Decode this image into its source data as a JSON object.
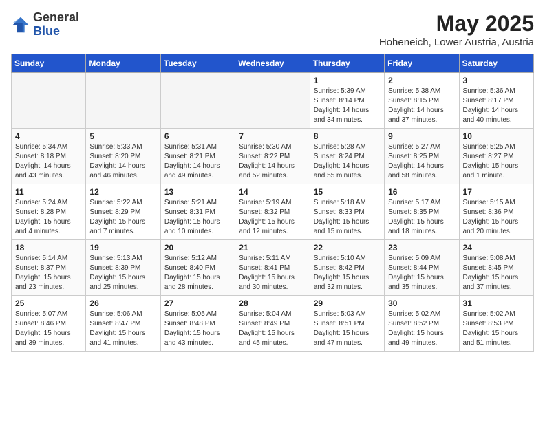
{
  "logo": {
    "general": "General",
    "blue": "Blue"
  },
  "title": {
    "month": "May 2025",
    "location": "Hoheneich, Lower Austria, Austria"
  },
  "weekdays": [
    "Sunday",
    "Monday",
    "Tuesday",
    "Wednesday",
    "Thursday",
    "Friday",
    "Saturday"
  ],
  "weeks": [
    [
      {
        "day": "",
        "info": ""
      },
      {
        "day": "",
        "info": ""
      },
      {
        "day": "",
        "info": ""
      },
      {
        "day": "",
        "info": ""
      },
      {
        "day": "1",
        "info": "Sunrise: 5:39 AM\nSunset: 8:14 PM\nDaylight: 14 hours\nand 34 minutes."
      },
      {
        "day": "2",
        "info": "Sunrise: 5:38 AM\nSunset: 8:15 PM\nDaylight: 14 hours\nand 37 minutes."
      },
      {
        "day": "3",
        "info": "Sunrise: 5:36 AM\nSunset: 8:17 PM\nDaylight: 14 hours\nand 40 minutes."
      }
    ],
    [
      {
        "day": "4",
        "info": "Sunrise: 5:34 AM\nSunset: 8:18 PM\nDaylight: 14 hours\nand 43 minutes."
      },
      {
        "day": "5",
        "info": "Sunrise: 5:33 AM\nSunset: 8:20 PM\nDaylight: 14 hours\nand 46 minutes."
      },
      {
        "day": "6",
        "info": "Sunrise: 5:31 AM\nSunset: 8:21 PM\nDaylight: 14 hours\nand 49 minutes."
      },
      {
        "day": "7",
        "info": "Sunrise: 5:30 AM\nSunset: 8:22 PM\nDaylight: 14 hours\nand 52 minutes."
      },
      {
        "day": "8",
        "info": "Sunrise: 5:28 AM\nSunset: 8:24 PM\nDaylight: 14 hours\nand 55 minutes."
      },
      {
        "day": "9",
        "info": "Sunrise: 5:27 AM\nSunset: 8:25 PM\nDaylight: 14 hours\nand 58 minutes."
      },
      {
        "day": "10",
        "info": "Sunrise: 5:25 AM\nSunset: 8:27 PM\nDaylight: 15 hours\nand 1 minute."
      }
    ],
    [
      {
        "day": "11",
        "info": "Sunrise: 5:24 AM\nSunset: 8:28 PM\nDaylight: 15 hours\nand 4 minutes."
      },
      {
        "day": "12",
        "info": "Sunrise: 5:22 AM\nSunset: 8:29 PM\nDaylight: 15 hours\nand 7 minutes."
      },
      {
        "day": "13",
        "info": "Sunrise: 5:21 AM\nSunset: 8:31 PM\nDaylight: 15 hours\nand 10 minutes."
      },
      {
        "day": "14",
        "info": "Sunrise: 5:19 AM\nSunset: 8:32 PM\nDaylight: 15 hours\nand 12 minutes."
      },
      {
        "day": "15",
        "info": "Sunrise: 5:18 AM\nSunset: 8:33 PM\nDaylight: 15 hours\nand 15 minutes."
      },
      {
        "day": "16",
        "info": "Sunrise: 5:17 AM\nSunset: 8:35 PM\nDaylight: 15 hours\nand 18 minutes."
      },
      {
        "day": "17",
        "info": "Sunrise: 5:15 AM\nSunset: 8:36 PM\nDaylight: 15 hours\nand 20 minutes."
      }
    ],
    [
      {
        "day": "18",
        "info": "Sunrise: 5:14 AM\nSunset: 8:37 PM\nDaylight: 15 hours\nand 23 minutes."
      },
      {
        "day": "19",
        "info": "Sunrise: 5:13 AM\nSunset: 8:39 PM\nDaylight: 15 hours\nand 25 minutes."
      },
      {
        "day": "20",
        "info": "Sunrise: 5:12 AM\nSunset: 8:40 PM\nDaylight: 15 hours\nand 28 minutes."
      },
      {
        "day": "21",
        "info": "Sunrise: 5:11 AM\nSunset: 8:41 PM\nDaylight: 15 hours\nand 30 minutes."
      },
      {
        "day": "22",
        "info": "Sunrise: 5:10 AM\nSunset: 8:42 PM\nDaylight: 15 hours\nand 32 minutes."
      },
      {
        "day": "23",
        "info": "Sunrise: 5:09 AM\nSunset: 8:44 PM\nDaylight: 15 hours\nand 35 minutes."
      },
      {
        "day": "24",
        "info": "Sunrise: 5:08 AM\nSunset: 8:45 PM\nDaylight: 15 hours\nand 37 minutes."
      }
    ],
    [
      {
        "day": "25",
        "info": "Sunrise: 5:07 AM\nSunset: 8:46 PM\nDaylight: 15 hours\nand 39 minutes."
      },
      {
        "day": "26",
        "info": "Sunrise: 5:06 AM\nSunset: 8:47 PM\nDaylight: 15 hours\nand 41 minutes."
      },
      {
        "day": "27",
        "info": "Sunrise: 5:05 AM\nSunset: 8:48 PM\nDaylight: 15 hours\nand 43 minutes."
      },
      {
        "day": "28",
        "info": "Sunrise: 5:04 AM\nSunset: 8:49 PM\nDaylight: 15 hours\nand 45 minutes."
      },
      {
        "day": "29",
        "info": "Sunrise: 5:03 AM\nSunset: 8:51 PM\nDaylight: 15 hours\nand 47 minutes."
      },
      {
        "day": "30",
        "info": "Sunrise: 5:02 AM\nSunset: 8:52 PM\nDaylight: 15 hours\nand 49 minutes."
      },
      {
        "day": "31",
        "info": "Sunrise: 5:02 AM\nSunset: 8:53 PM\nDaylight: 15 hours\nand 51 minutes."
      }
    ]
  ]
}
